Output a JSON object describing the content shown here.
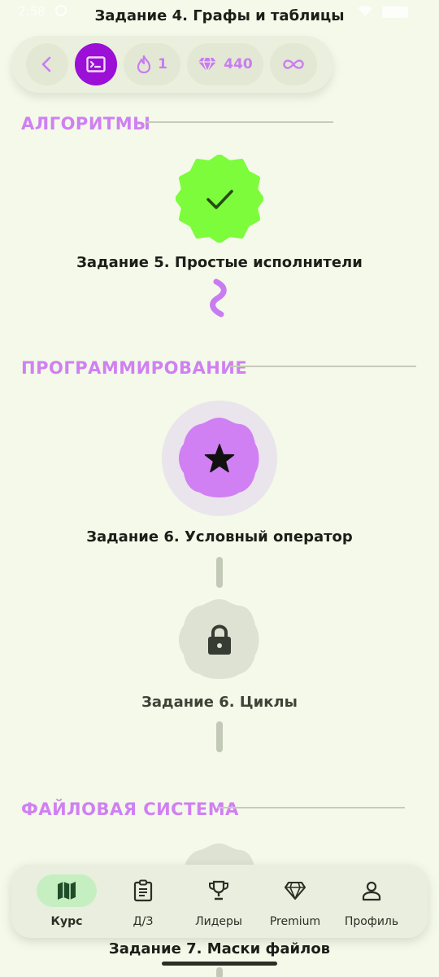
{
  "status_bar": {
    "time": "2:58"
  },
  "header": {
    "title": "Задание 4. Графы и таблицы"
  },
  "toolbar": {
    "back_icon": "chevron-left-icon",
    "console_icon": "terminal-icon",
    "streak_count": "1",
    "gems_count": "440",
    "infinity_icon": "infinity-icon"
  },
  "sections": {
    "algorithms": {
      "title": "АЛГОРИТМЫ"
    },
    "programming": {
      "title": "ПРОГРАММИРОВАНИЕ"
    },
    "filesystem": {
      "title": "ФАЙЛОВАЯ СИСТЕМА"
    }
  },
  "lessons": {
    "task5": {
      "label": "Задание 5. Простые исполнители",
      "state": "completed"
    },
    "task6_cond": {
      "label": "Задание 6. Условный оператор",
      "state": "current"
    },
    "task6_loops": {
      "label": "Задание 6. Циклы",
      "state": "locked"
    },
    "task7": {
      "label": "Задание 7. Маски файлов",
      "state": "locked"
    }
  },
  "colors": {
    "accent_purple": "#d080f2",
    "active_purple": "#9b0fd6",
    "completed_green": "#7dfc3c",
    "locked_gray": "#dde2d3",
    "background": "#f4f9ea"
  },
  "bottom_nav": {
    "items": [
      {
        "label": "Курс",
        "icon": "map-icon",
        "active": true
      },
      {
        "label": "Д/З",
        "icon": "clipboard-icon",
        "active": false
      },
      {
        "label": "Лидеры",
        "icon": "trophy-icon",
        "active": false
      },
      {
        "label": "Premium",
        "icon": "diamond-icon",
        "active": false
      },
      {
        "label": "Профиль",
        "icon": "person-icon",
        "active": false
      }
    ]
  }
}
